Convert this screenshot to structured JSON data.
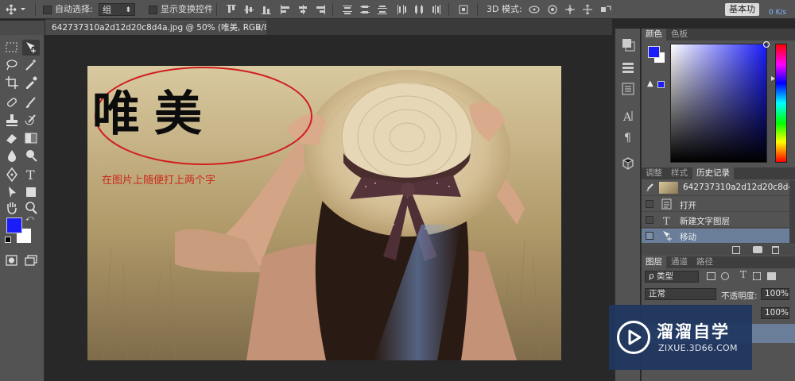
{
  "option_bar": {
    "auto_select_label": "自动选择:",
    "auto_select_value": "组",
    "show_transform_label": "显示变换控件",
    "mode_3d_label": "3D 模式:",
    "workspace_label": "基本功",
    "net_speed": "0 K/s"
  },
  "document": {
    "tab_title": "642737310a2d12d20c8d4a.jpg @ 50% (唯美, RGB/8#) *",
    "close_glyph": "×"
  },
  "canvas": {
    "big_text": "唯美",
    "note": "在图片上随便打上两个字"
  },
  "colors": {
    "foreground": "#1a1dfa",
    "background": "#ffffff",
    "accent_red": "#cc2a1a",
    "history_selected": "#6a7e9a"
  },
  "color_panel": {
    "tabs": [
      "颜色",
      "色板"
    ]
  },
  "history_panel": {
    "tabs": [
      "调整",
      "样式",
      "历史记录"
    ],
    "snapshot": "642737310a2d12d20c8d4a.jpg",
    "items": [
      {
        "label": "打开",
        "icon": "document-icon"
      },
      {
        "label": "新建文字图层",
        "icon": "type-icon"
      },
      {
        "label": "移动",
        "icon": "move-icon"
      }
    ]
  },
  "layers_panel": {
    "tabs": [
      "图层",
      "通道",
      "路径"
    ],
    "filter_kind": "ρ 类型",
    "blend_mode": "正常",
    "opacity_label": "不透明度:",
    "opacity_value": "100%",
    "fill_value": "100%"
  },
  "watermark": {
    "title": "溜溜自学",
    "url": "ZIXUE.3D66.COM"
  }
}
